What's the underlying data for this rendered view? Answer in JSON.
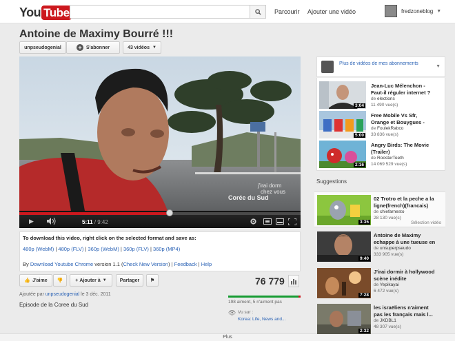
{
  "masthead": {
    "logo_you": "You",
    "logo_tube": "Tube",
    "search_value": "",
    "browse": "Parcourir",
    "upload": "Ajouter une vidéo",
    "username": "fredzoneblog"
  },
  "video": {
    "title": "Antoine de Maximy Bourré !!!",
    "channel": "unpseudogenial",
    "subscribe": "S'abonner",
    "video_count": "43 vidéos",
    "current_time": "5:11",
    "duration": "/ 9:42",
    "progress": 0.535,
    "watermark_line1": "j'irai dorm",
    "watermark_line2": "chez vous",
    "watermark_line3": "Corée du Sud"
  },
  "download": {
    "heading": "To download this video, right click on the selected format and save as:",
    "formats": [
      "480p (WebM)",
      "480p (FLV)",
      "360p (WebM)",
      "360p (FLV)",
      "360p (MP4)"
    ],
    "by_prefix": "By",
    "by_link": "Download Youtube Chrome",
    "version_text": "version 1.1 (",
    "check_link": "Check New Version",
    "close_paren": ")",
    "feedback": "Feedback",
    "help": "Help"
  },
  "actions": {
    "like": "J'aime",
    "add_to": "Ajouter à",
    "share": "Partager",
    "views": "76 779",
    "likes_text": "198 aiment, 5 n'aiment pas",
    "like_ratio": 0.975,
    "seen_on": "Vu sur :",
    "seen_location": "Korea: Life, News and..."
  },
  "meta": {
    "added_by": "Ajoutée par",
    "uploader": "unpseudogenial",
    "date": "le 3 déc. 2011",
    "description": "Episode de la Coree du Sud",
    "more": "Plus"
  },
  "sidebar": {
    "subs_title": "Plus de vidéos de mes abonnements",
    "subs_videos": [
      {
        "title_1": "Jean-Luc Mélenchon -",
        "title_2": "Faut-il réguler internet ?",
        "by_prefix": "de ",
        "by": "elections",
        "views": "11 490 vue(s)",
        "duration": "3:04"
      },
      {
        "title_1": "Free Mobile Vs Sfr,",
        "title_2": "Orange et Bouygues -",
        "by_prefix": "de ",
        "by": "FoulekRabco",
        "views": "33 836 vue(s)",
        "duration": "5:00"
      },
      {
        "title_1": "Angry Birds: The Movie",
        "title_2": "(Trailer)",
        "by_prefix": "de ",
        "by": "RoosterTeeth",
        "views": "14 069 529 vue(s)",
        "duration": "2:16"
      }
    ],
    "suggestions_label": "Suggestions",
    "selected_label": "Sélection vidéo",
    "suggestions": [
      {
        "title_1": "02 Trotro et la peche a la",
        "title_2": "ligne(french)(francais)",
        "by_prefix": "de ",
        "by": "chiefarnesto",
        "views": "28 130 vue(s)",
        "duration": "3:35"
      },
      {
        "title_1": "Antoine de Maximy",
        "title_2": "echappe à une tueuse en",
        "by_prefix": "de ",
        "by": "unsuperpseudo",
        "views": "333 905 vue(s)",
        "duration": "9:40"
      },
      {
        "title_1": "J'irai dormir à hollywood",
        "title_2": "scène inédite",
        "by_prefix": "de ",
        "by": "Yepikayai",
        "views": "6 472 vue(s)",
        "duration": "7:28"
      },
      {
        "title_1": "les israëliens n'aiment",
        "title_2": "pas les français mais l...",
        "by_prefix": "de ",
        "by": "JKDBL1",
        "views": "48 307 vue(s)",
        "duration": "2:32"
      }
    ]
  }
}
